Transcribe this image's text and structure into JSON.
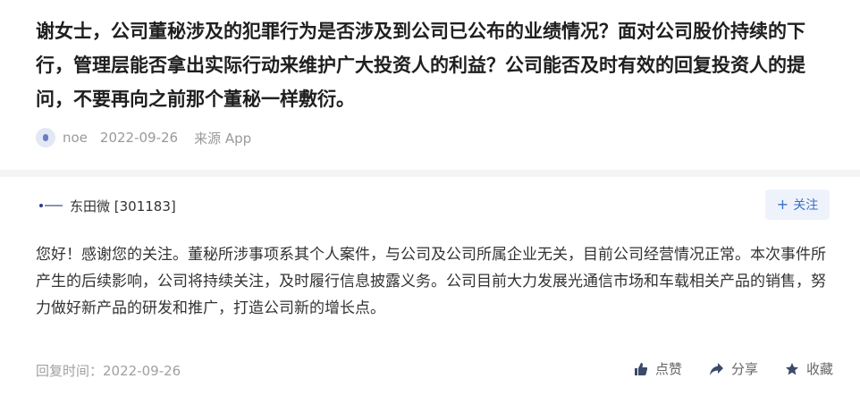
{
  "question": {
    "text": "谢女士，公司董秘涉及的犯罪行为是否涉及到公司已公布的业绩情况？面对公司股价持续的下行，管理层能否拿出实际行动来维护广大投资人的利益？公司能否及时有效的回复投资人的提问，不要再向之前那个董秘一样敷衍。",
    "asker_name": "noe",
    "date": "2022-09-26",
    "source": "来源 App",
    "avatar_icon": "user-avatar-icon"
  },
  "answer": {
    "company": "东田微 [301183]",
    "follow_label": "关注",
    "follow_icon": "plus-icon",
    "text": "您好！感谢您的关注。董秘所涉事项系其个人案件，与公司及公司所属企业无关，目前公司经营情况正常。本次事件所产生的后续影响，公司将持续关注，及时履行信息披露义务。公司目前大力发展光通信市场和车载相关产品的销售，努力做好新产品的研发和推广，打造公司新的增长点。",
    "reply_time_label": "回复时间：",
    "reply_time": "2022-09-26",
    "actions": [
      {
        "label": "点赞",
        "icon": "thumbs-up-icon"
      },
      {
        "label": "分享",
        "icon": "share-icon"
      },
      {
        "label": "收藏",
        "icon": "star-icon"
      }
    ]
  },
  "colors": {
    "accent": "#3a6fc9",
    "follow_bg": "#eef3fb",
    "separator": "#f3f4f6",
    "muted_text": "#9a9a9a"
  }
}
